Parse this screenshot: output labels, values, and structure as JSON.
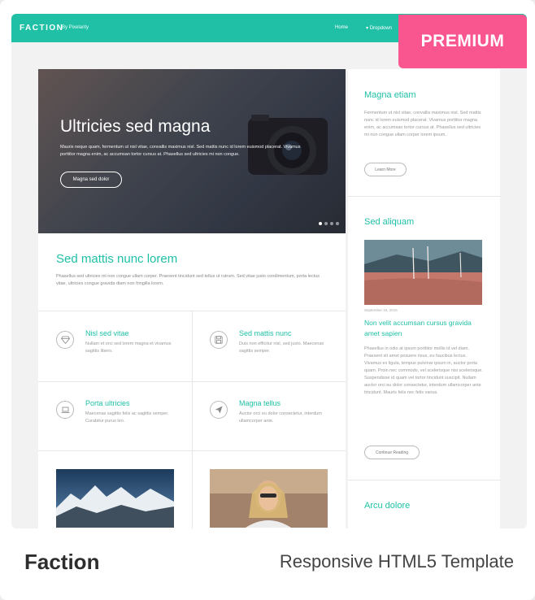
{
  "header": {
    "logo": "FACTION",
    "byline": "By Pixelarity",
    "nav": [
      "Home",
      "Dropdown"
    ]
  },
  "badge": "PREMIUM",
  "hero": {
    "title": "Ultricies sed magna",
    "text": "Mauris neque quam, fermentum ut nisl vitae, convallis maximus nisl. Sed mattis nunc id lorem euismod placerat. Vivamus porttitor magna enim, ac accumsan tortor cursus at. Phasellus sed ultricies mi non congue.",
    "button": "Magna sed dolor"
  },
  "intro": {
    "title": "Sed mattis nunc lorem",
    "text": "Phasellus sed ultricies mi non congue ullam corper. Praesent tincidunt sed tellus ut rutrum. Sed vitae justo condimentum, porta lectus vitae, ultricies congue gravida diam non fringilla lorem."
  },
  "features": [
    {
      "title": "Nisl sed vitae",
      "text": "Nullam et orci sed lorem magna et vivamus sagittis libero."
    },
    {
      "title": "Sed mattis nunc",
      "text": "Duis non efficitur nisl, sed justo. Maecenas sagittis semper."
    },
    {
      "title": "Porta ultricies",
      "text": "Maecenas sagittis felis ac sagittis semper. Curabitur purus leo."
    },
    {
      "title": "Magna tellus",
      "text": "Auctor orci eu dolor consectetur, interdum ullamcorper ante."
    }
  ],
  "sidebar": {
    "first": {
      "title": "Magna etiam",
      "text": "Fermentum ut nisl vitae, convallis maximus nisl. Sed mattis nunc id lorem euismod placerat. Vivamus porttitor magna enim, ac accumsan tortor cursus at. Phasellus sed ultricies mi non congue ullam corper lorem ipsum.",
      "button": "Learn More"
    },
    "second": {
      "title": "Sed aliquam",
      "date": "September 15, 2016",
      "link": "Non velit accumsan cursus gravida amet sapien",
      "text": "Phasellus in odio at ipsum porttitor mollis id vel diam. Praesent sit amet posuere risus, eu faucibus lectus. Vivamus ex ligula, tempus pulvinar ipsum in, auctor porta quam. Proin nec commodo, vel scelerisque nisi scelerisque. Suspendisse id quam vel tortor tincidunt suscipit. Nullam auctor orci eu dolor consectetur, interdum ullamcorper ante tincidunt. Mauris felis nec felis varius.",
      "button": "Continue Reading"
    },
    "third": {
      "title": "Arcu dolore"
    }
  },
  "footer": {
    "name": "Faction",
    "description": "Responsive HTML5 Template"
  },
  "colors": {
    "accent": "#1fc0a6",
    "badge": "#f9558f"
  }
}
